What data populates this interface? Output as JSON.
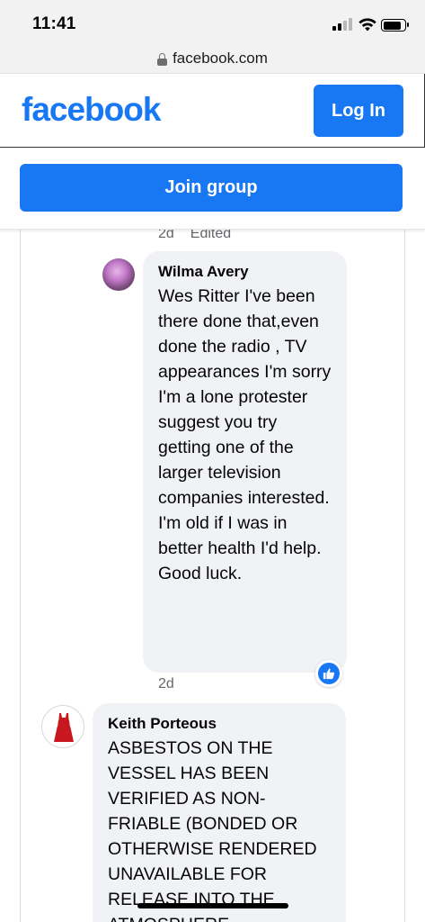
{
  "status_bar": {
    "time": "11:41",
    "icons": [
      "cellular-signal-icon",
      "wifi-icon",
      "battery-icon"
    ]
  },
  "browser": {
    "url": "facebook.com",
    "icon": "lock-icon"
  },
  "header": {
    "logo_text": "facebook",
    "login_label": "Log In",
    "brand_color": "#1877f2"
  },
  "join_bar": {
    "join_label": "Join group"
  },
  "comments": [
    {
      "meta_time": "2d",
      "meta_edited": "Edited"
    },
    {
      "author": "Wilma Avery",
      "text": "Wes Ritter I've been there done that,even done the radio , TV appearances I'm sorry I'm a lone protester suggest you try getting one of the larger television companies interested. I'm old if I was in better health I'd help. Good luck.",
      "reaction_icon": "like-reaction-icon",
      "meta_time": "2d"
    },
    {
      "author": "Keith Porteous",
      "text": "ASBESTOS ON THE VESSEL HAS BEEN VERIFIED AS NON-FRIABLE (BONDED OR OTHERWISE RENDERED UNAVAILABLE FOR RELEASE INTO THE ATMOSPHERE"
    }
  ]
}
